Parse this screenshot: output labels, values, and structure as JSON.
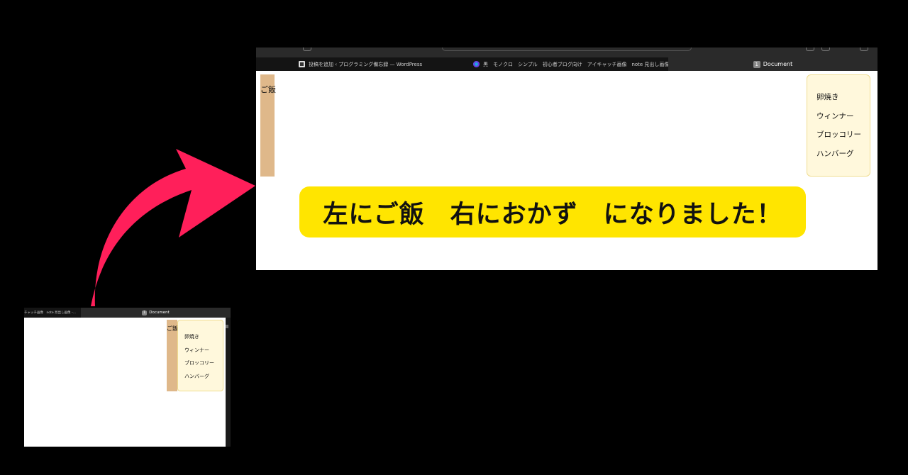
{
  "colors": {
    "background": "#000000",
    "arrow": "#ff1f5a",
    "banner": "#ffe500",
    "rice_strip": "#dfb88a",
    "side_dish_box": "#fff8dc"
  },
  "big_screen": {
    "tabs": [
      {
        "icon": "wordpress-icon",
        "label": "投稿を追加 ‹ プログラミング備忘録 — WordPress"
      },
      {
        "icon": "canva-icon",
        "label": "黒　モノクロ　シンプル　初心者ブログ向け　アイキャッチ画像　note 見出し画像 -..."
      },
      {
        "badge": "1",
        "label": "Document"
      }
    ],
    "left_label": "ご飯",
    "right_menu": [
      "卵焼き",
      "ウィンナー",
      "ブロッコリー",
      "ハンバーグ"
    ]
  },
  "banner": {
    "text": "左にご飯　右におかず　になりました！"
  },
  "small_screen": {
    "tabs": [
      {
        "label": "チャッチ画像　note 見出し画像 -..."
      },
      {
        "badge": "1",
        "label": "Document"
      }
    ],
    "left_label": "ご飯",
    "right_menu": [
      "卵焼き",
      "ウィンナー",
      "ブロッコリー",
      "ハンバーグ"
    ]
  }
}
